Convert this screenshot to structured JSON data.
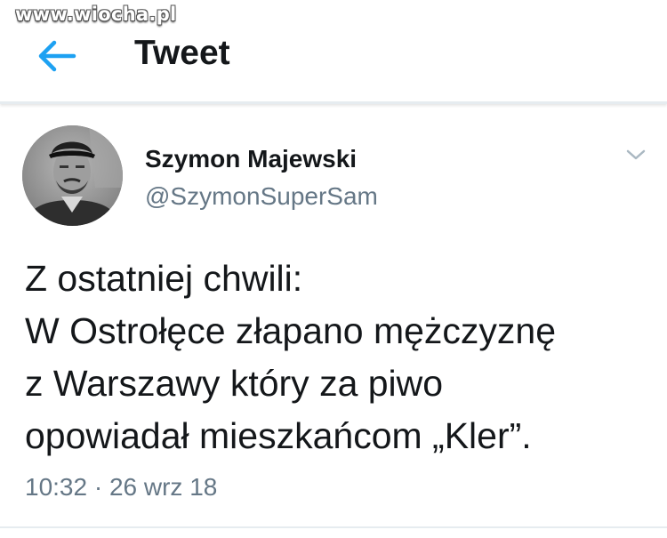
{
  "watermark": "www.wiocha.pl",
  "header": {
    "title": "Tweet"
  },
  "tweet": {
    "author_name": "Szymon Majewski",
    "author_handle": "@SzymonSuperSam",
    "text_lines": [
      "Z ostatniej chwili:",
      "W Ostrołęce złapano mężczyznę",
      "z Warszawy który za piwo",
      "opowiadał mieszkańcom „Kler”."
    ],
    "timestamp": "10:32 · 26 wrz 18"
  },
  "icons": {
    "back": "arrow-left-icon",
    "menu": "chevron-down-icon"
  },
  "colors": {
    "accent": "#1da1f2",
    "text": "#14171a",
    "secondary": "#657786",
    "divider": "#e6ecf0"
  }
}
